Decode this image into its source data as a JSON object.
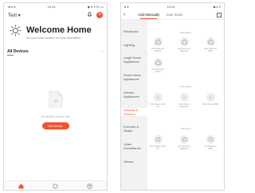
{
  "left": {
    "status": {
      "carrier": "Text ▾",
      "time": "19:14",
      "battery": "◆ ▾ 17% ▭"
    },
    "home_name": "Text ▾",
    "welcome": {
      "title": "Welcome Home",
      "subtitle": "Set your home location for more information ›"
    },
    "devices": {
      "title": "All Devices",
      "more": "···"
    },
    "empty": {
      "text": "No devices, please add",
      "button": "Add Device"
    }
  },
  "right": {
    "status": {
      "carrier": "● ▾",
      "time": "19:15",
      "battery": "◆ ▾ 2"
    },
    "tabs": [
      "Add Manually",
      "Auto Scan"
    ],
    "categories": [
      "Electrician",
      "Lighting",
      "Large Home Appliances",
      "Small Home Appliances",
      "Kitchen Appliances",
      "Security & Sensors",
      "Exercise & Health",
      "Video Surveillance",
      "Others"
    ],
    "sections": [
      {
        "title": "Gas Alarm",
        "devices": [
          "Gas Detector (Wi-Fi)",
          "Gas Detector (Zigbee)",
          "Gas Detector (NB)",
          "Gas Detector (other)"
        ]
      },
      {
        "title": "CO2 Alarm",
        "devices": [
          "CO2 Alarm (Wi-Fi)",
          "CO2 Alarm (Zigbee)",
          "CO2 Alarm (NB)"
        ]
      },
      {
        "title": "CO Alarm",
        "devices": [
          "CO Detector (Wi-Fi)",
          "CO Detector (Zigbee)",
          "CO Detector (NB)"
        ]
      }
    ]
  },
  "colors": {
    "accent": "#f0552f",
    "sidebar": "#f2f2f2",
    "icon_bg": "#ececec"
  }
}
